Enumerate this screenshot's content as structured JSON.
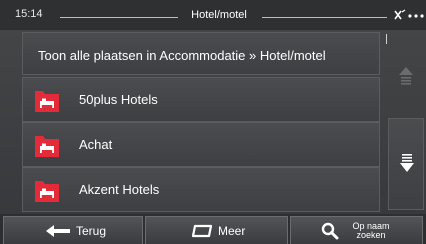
{
  "status": {
    "time": "15:14",
    "title": "Hotel/motel"
  },
  "list": {
    "header": "Toon alle plaatsen in Accommodatie » Hotel/motel",
    "items": [
      {
        "label": "50plus Hotels",
        "icon": "hotel-bed-icon"
      },
      {
        "label": "Achat",
        "icon": "hotel-bed-icon"
      },
      {
        "label": "Akzent Hotels",
        "icon": "hotel-bed-icon"
      }
    ]
  },
  "bottom": {
    "back_label": "Terug",
    "more_label": "Meer",
    "search_line1": "Op naam",
    "search_line2": "zoeken"
  },
  "colors": {
    "icon_red": "#e32b3a",
    "background": "#3a3b3d"
  }
}
